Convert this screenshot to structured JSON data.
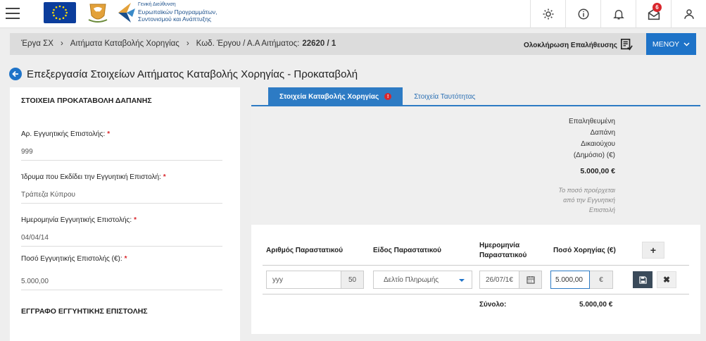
{
  "header": {
    "logo_text_line1": "Γενική Διεύθυνση",
    "logo_text_line2": "Ευρωπαϊκών Προγραμμάτων,",
    "logo_text_line3": "Συντονισμού και Ανάπτυξης",
    "notifications_count": "6",
    "icons": [
      "menu-icon",
      "gear-icon",
      "info-icon",
      "bell-icon",
      "mail-icon",
      "user-icon"
    ]
  },
  "breadcrumb": {
    "item1": "Έργα ΣΧ",
    "item2": "Αιτήματα Καταβολής Χορηγίας",
    "item3_prefix": "Κωδ. Έργου / Α.Α Αιτήματος:",
    "item3_value": "22620 / 1",
    "verify_label": "Ολοκλήρωση Επαλήθευσης",
    "menu_label": "ΜΕΝΟΥ"
  },
  "page": {
    "title": "Επεξεργασία Στοιχείων Αιτήματος Καταβολής Χορηγίας - Προκαταβολή"
  },
  "left": {
    "section1_title": "ΣΤΟΙΧΕΙΑ ΠΡΟΚΑΤΑΒΟΛΗ ΔΑΠΑΝΗΣ",
    "fields": [
      {
        "label": "Αρ. Εγγυητικής Επιστολής:",
        "value": "999"
      },
      {
        "label": "Ίδρυμα που Εκδίδει την Εγγυητική Επιστολή:",
        "value": "Τράπεζα Κύπρου"
      },
      {
        "label": "Ημερομηνία Εγγυητικής Επιστολής:",
        "value": "04/04/14"
      },
      {
        "label": "Ποσό Εγγυητικής Επιστολής (€):",
        "value": "5.000,00"
      }
    ],
    "required_mark": "*",
    "section2_title": "ΕΓΓΡΑΦΟ ΕΓΓΥΗΤΙΚΗΣ ΕΠΙΣΤΟΛΗΣ"
  },
  "tabs": {
    "active": "Στοιχεία Καταβολής Χορηγίας",
    "active_error": "!",
    "inactive": "Στοιχεία Ταυτότητας"
  },
  "summary": {
    "label_line1": "Επαληθευμένη",
    "label_line2": "Δαπάνη",
    "label_line3": "Δικαιούχου",
    "label_line4": "(Δημόσιο) (€)",
    "value": "5.000,00 €",
    "note_line1": "Το ποσό προέρχεται",
    "note_line2": "από την Εγγυητική",
    "note_line3": "Επιστολή"
  },
  "grid": {
    "col1": "Αριθμός Παραστατικού",
    "col2": "Είδος Παραστατικού",
    "col3_line1": "Ημερομηνία",
    "col3_line2": "Παραστατικού",
    "col4": "Ποσό Χορηγίας (€)",
    "add_label": "+",
    "row": {
      "doc_number_placeholder": "yyy",
      "doc_number_suffix": "50",
      "doc_type": "Δελτίο Πληρωμής",
      "date": "26/07/1€",
      "amount": "5.000,00",
      "currency": "€",
      "delete_label": "✖"
    },
    "total_label": "Σύνολο:",
    "total_value": "5.000,00 €"
  },
  "colors": {
    "primary": "#1e73c8",
    "tab_active": "#2d7bc4",
    "error": "#d9262c"
  }
}
